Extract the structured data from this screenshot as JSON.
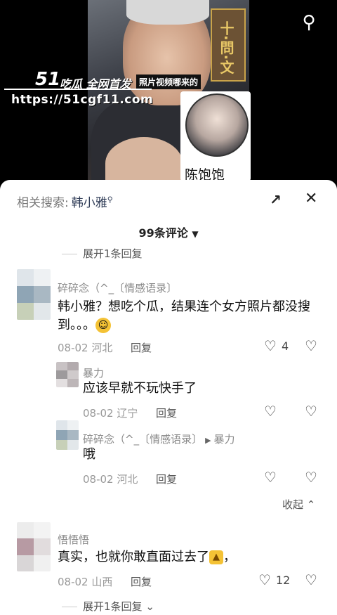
{
  "video": {
    "logo": "51",
    "logo_tag": "吃瓜 全网首发",
    "caption": "照片视频哪来的",
    "url": "https://51cgf11.com",
    "poster_text": "十·問·文",
    "profile_name": "陈饱饱",
    "search_icon": "search-icon"
  },
  "panel": {
    "related_label": "相关搜索:",
    "related_keyword": "韩小雅",
    "expand_icon": "expand-icon",
    "close_icon": "close-icon",
    "comment_count": "99条评论"
  },
  "expand_top": "展开1条回复",
  "comments": [
    {
      "name": "碎碎念（^_〔情感语录〕",
      "text": "韩小雅？想吃个瓜，结果连个女方照片都没搜到。。。",
      "date": "08-02",
      "region": "河北",
      "reply": "回复",
      "likes": "4",
      "avatar_colors": [
        "#dfe5ea",
        "#eef1f3",
        "#8fa5b5",
        "#a9b8c3",
        "#c7d0b8",
        "#e2e7ea"
      ]
    },
    {
      "name": "暴力",
      "text": "应该早就不玩快手了",
      "date": "08-02",
      "region": "辽宁",
      "reply": "回复",
      "likes": "",
      "avatar_colors": [
        "#c8c2c4",
        "#b3abae",
        "#9d9a9c",
        "#cfcacb",
        "#e3dfe0",
        "#bdb6b8"
      ]
    },
    {
      "name": "碎碎念（^_〔情感语录〕",
      "reply_to": "暴力",
      "text": "哦",
      "date": "08-02",
      "region": "河北",
      "reply": "回复",
      "likes": "",
      "avatar_colors": [
        "#dfe5ea",
        "#eef1f3",
        "#8fa5b5",
        "#a9b8c3",
        "#c7d0b8",
        "#e2e7ea"
      ]
    },
    {
      "name": "悟悟悟",
      "text": "真实，也就你敢直面过去了",
      "date": "08-02",
      "region": "山西",
      "reply": "回复",
      "likes": "12",
      "avatar_colors": [
        "#ececec",
        "#f3f3f3",
        "#b79aa3",
        "#e1dcdd",
        "#d9d6d7",
        "#f0f0f0"
      ]
    }
  ],
  "collapse_label": "收起",
  "expand_bottom": "展开1条回复"
}
